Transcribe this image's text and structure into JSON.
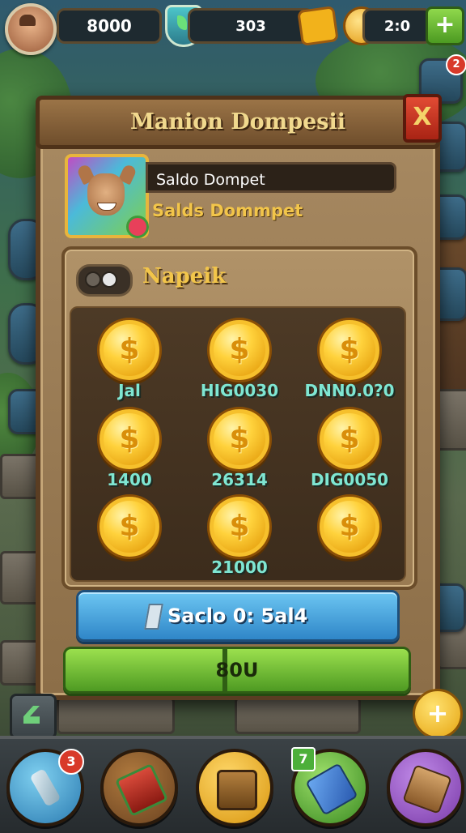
{
  "hud": {
    "player_count": "8000",
    "shield_value": "303",
    "coin_value": "2:0"
  },
  "dialog": {
    "title": "Manion Dompesii",
    "close_label": "X",
    "profile_name": "Saldo Dompet",
    "profile_subtitle": "Salds Dommpet",
    "section_title": "Napeik",
    "coins": [
      {
        "symbol": "$",
        "value": "Jal"
      },
      {
        "symbol": "$",
        "value": "HIG0030"
      },
      {
        "symbol": "$",
        "value": "DNN0.0?0"
      },
      {
        "symbol": "$",
        "value": "1400"
      },
      {
        "symbol": "$",
        "value": "26314"
      },
      {
        "symbol": "$",
        "value": "DIG0050"
      },
      {
        "symbol": "$",
        "value": ""
      },
      {
        "symbol": "$",
        "value": "21000"
      },
      {
        "symbol": "$",
        "value": ""
      }
    ],
    "blue_button_label": "Saclo 0: 5al4",
    "green_button_label": "80U"
  },
  "side": {
    "top_badge": "2"
  },
  "bottom_nav": {
    "badge_left": "3",
    "badge_green": "7",
    "plus_label": "+"
  },
  "colors": {
    "coin_value_text": "#7fe6d2",
    "title_text": "#f1d98e",
    "accent_gold": "#f2c54a"
  },
  "icons": [
    "avatar",
    "shield-icon",
    "star-icon",
    "coin-icon",
    "plus-icon",
    "close-icon",
    "toggle-icon",
    "gem-icon",
    "back-icon",
    "potion-icon",
    "scroll-icon",
    "chest-icon",
    "crystal-icon",
    "wood-icon"
  ]
}
